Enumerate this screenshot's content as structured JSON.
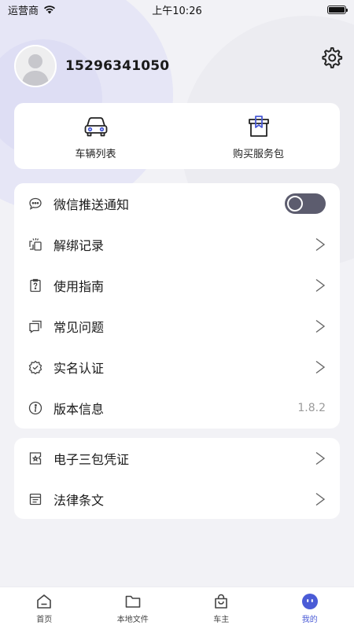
{
  "status": {
    "carrier": "运营商",
    "time": "上午10:26"
  },
  "profile": {
    "phone": "15296341050"
  },
  "quick": [
    {
      "label": "车辆列表",
      "icon": "car-icon"
    },
    {
      "label": "购买服务包",
      "icon": "service-package-icon"
    }
  ],
  "menu1": [
    {
      "label": "微信推送通知",
      "icon": "chat-bubble-icon",
      "control": "toggle",
      "toggle_on": false
    },
    {
      "label": "解绑记录",
      "icon": "unbind-record-icon",
      "control": "chevron"
    },
    {
      "label": "使用指南",
      "icon": "guide-icon",
      "control": "chevron"
    },
    {
      "label": "常见问题",
      "icon": "faq-icon",
      "control": "chevron"
    },
    {
      "label": "实名认证",
      "icon": "verified-shield-icon",
      "control": "chevron"
    },
    {
      "label": "版本信息",
      "icon": "info-icon",
      "control": "value",
      "value": "1.8.2"
    }
  ],
  "menu2": [
    {
      "label": "电子三包凭证",
      "icon": "warranty-ticket-icon",
      "control": "chevron"
    },
    {
      "label": "法律条文",
      "icon": "document-icon",
      "control": "chevron"
    }
  ],
  "tabs": [
    {
      "label": "首页",
      "icon": "home-icon",
      "active": false
    },
    {
      "label": "本地文件",
      "icon": "folder-icon",
      "active": false
    },
    {
      "label": "车主",
      "icon": "shopping-bag-icon",
      "active": false
    },
    {
      "label": "我的",
      "icon": "profile-face-icon",
      "active": true
    }
  ],
  "colors": {
    "accent": "#4a5bd6",
    "toggle": "#5c5c6e",
    "background": "#f2f2f6"
  },
  "chevron": ">"
}
